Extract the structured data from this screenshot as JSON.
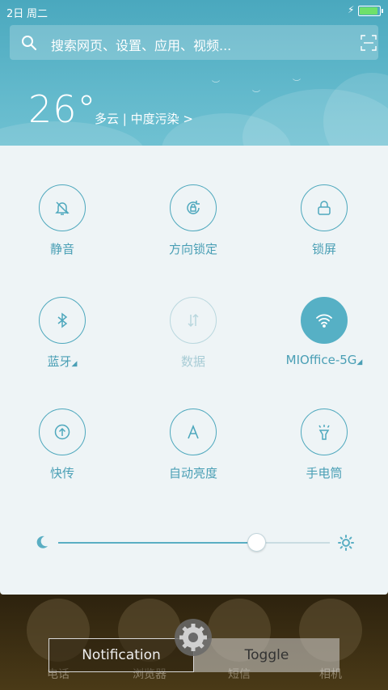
{
  "status": {
    "date": "2日",
    "weekday": "周二",
    "battery_level": 0.95
  },
  "search": {
    "placeholder": "搜索网页、设置、应用、视频..."
  },
  "weather": {
    "temperature": "26°",
    "description": "多云 | 中度污染 >"
  },
  "toggles": [
    {
      "label": "静音",
      "icon": "bell-off-icon",
      "state": "off"
    },
    {
      "label": "方向锁定",
      "icon": "rotation-lock-icon",
      "state": "off"
    },
    {
      "label": "锁屏",
      "icon": "lock-icon",
      "state": "off"
    },
    {
      "label": "蓝牙",
      "icon": "bluetooth-icon",
      "state": "off",
      "expandable": true
    },
    {
      "label": "数据",
      "icon": "data-arrows-icon",
      "state": "disabled"
    },
    {
      "label": "MIOffice-5G",
      "icon": "wifi-icon",
      "state": "on",
      "expandable": true
    },
    {
      "label": "快传",
      "icon": "share-icon",
      "state": "off"
    },
    {
      "label": "自动亮度",
      "icon": "auto-brightness-icon",
      "state": "off"
    },
    {
      "label": "手电筒",
      "icon": "flashlight-icon",
      "state": "off"
    }
  ],
  "brightness": {
    "level": 0.73
  },
  "dock": {
    "apps": [
      "电话",
      "浏览器",
      "短信",
      "相机"
    ]
  },
  "overlay": {
    "notification_label": "Notification",
    "toggle_label": "Toggle"
  },
  "colors": {
    "accent": "#4ea8bd",
    "header": "#5fb6c9",
    "panel": "#eef4f6"
  }
}
